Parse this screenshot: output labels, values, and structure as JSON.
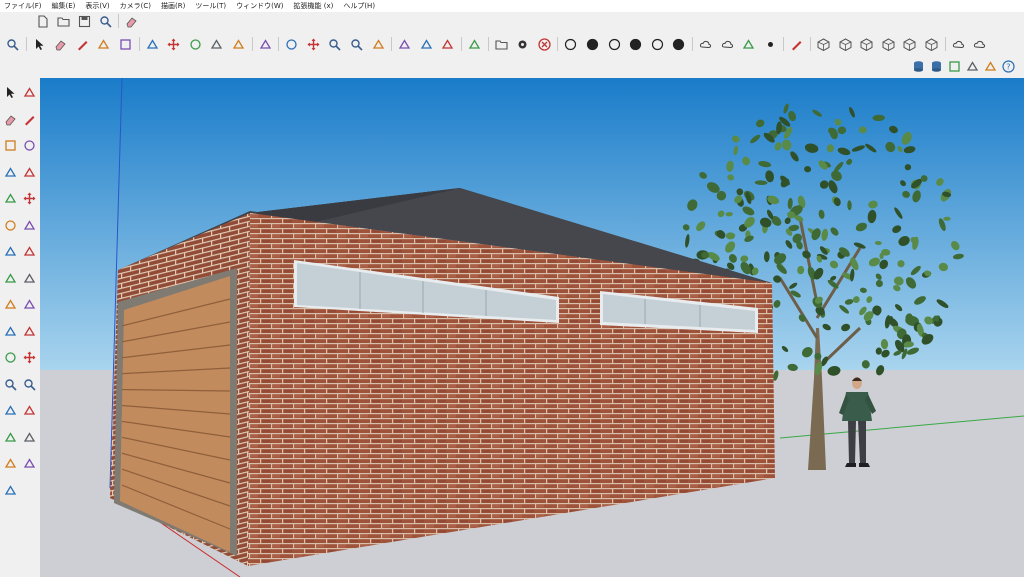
{
  "menu": {
    "items": [
      "ファイル(F)",
      "編集(E)",
      "表示(V)",
      "カメラ(C)",
      "描画(R)",
      "ツール(T)",
      "ウィンドウ(W)",
      "拡張機能 (x)",
      "ヘルプ(H)"
    ]
  },
  "toolbar_top": {
    "icons": [
      "new-icon",
      "open-icon",
      "save-icon",
      "search-icon",
      "eraser-icon"
    ]
  },
  "toolbar_main": {
    "icons": [
      "zoom-icon",
      "select-icon",
      "eraser-icon",
      "pencil-icon",
      "arc-icon",
      "rectangle-icon",
      "push-pull-icon",
      "move-icon",
      "rotate-icon",
      "scale-icon",
      "offset-icon",
      "paint-bucket-icon",
      "orbit-icon",
      "pan-icon",
      "zoom-extents-icon",
      "zoom-window-icon",
      "section-plane-icon",
      "warehouse-icon",
      "layers-icon",
      "components-icon",
      "user-icon",
      "folder-icon",
      "gear-icon",
      "close-icon",
      "style-xray-icon",
      "style-wireframe-icon",
      "style-hidden-icon",
      "style-shaded-icon",
      "style-textured-icon",
      "style-mono-icon",
      "cloud-icon",
      "cloud-upload-icon",
      "export-icon",
      "point-icon",
      "dashed-line-icon",
      "view-iso-icon",
      "view-top-icon",
      "view-front-icon",
      "view-right-icon",
      "view-back-icon",
      "view-left-icon",
      "cloud-sync-icon",
      "cloud-download-icon"
    ]
  },
  "toolbar_right": {
    "icons": [
      "database-add-icon",
      "database-icon",
      "table-icon",
      "import-image-icon",
      "photo-icon",
      "help-icon"
    ]
  },
  "toolbar_left": {
    "icons": [
      "select-icon",
      "paint-icon",
      "eraser-icon",
      "line-icon",
      "rectangle-icon",
      "circle-icon",
      "arc-icon",
      "polygon-icon",
      "push-pull-icon",
      "move-icon",
      "rotate-icon",
      "scale-icon",
      "follow-me-icon",
      "offset-icon",
      "tape-measure-icon",
      "protractor-icon",
      "dimension-icon",
      "text-icon",
      "axes-icon",
      "3d-text-icon",
      "orbit-icon",
      "pan-icon",
      "zoom-icon",
      "zoom-extents-icon",
      "position-camera-icon",
      "walk-icon",
      "look-around-icon",
      "section-plane-icon",
      "layers-icon",
      "warehouse-icon",
      "components-icon"
    ]
  },
  "scene": {
    "sky_top": "#1a7cc9",
    "sky_bottom": "#a8d4ee",
    "ground": "#cdcfd4",
    "brick": "#a5573e",
    "mortar": "#e2cdb7",
    "roof": "#3f4146",
    "garage_door": "#c28b5e",
    "window_glass": "#c4d0d6",
    "foliage": "#3f6a35",
    "person_jacket": "#3a5c4b",
    "axis_red": "#cc2b2b",
    "axis_green": "#3aa845",
    "axis_blue": "#2a55cc"
  }
}
